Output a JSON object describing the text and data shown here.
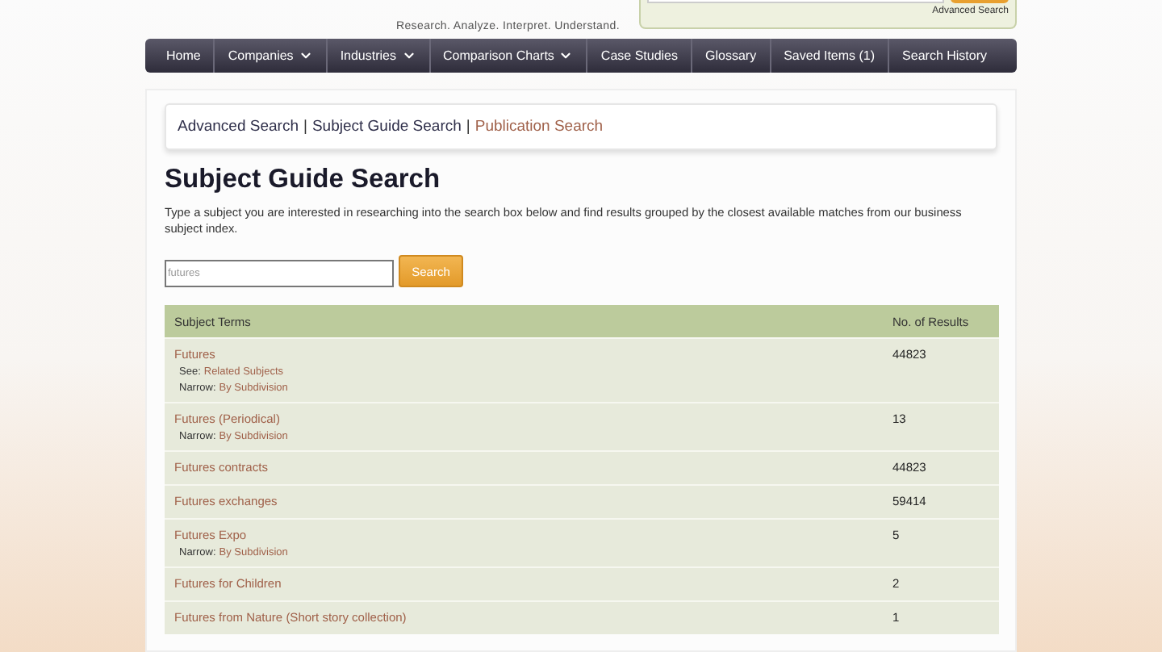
{
  "header": {
    "tagline": "Research. Analyze. Interpret. Understand.",
    "advanced_search_link": "Advanced Search"
  },
  "nav": [
    {
      "label": "Home",
      "has_menu": false
    },
    {
      "label": "Companies",
      "has_menu": true
    },
    {
      "label": "Industries",
      "has_menu": true
    },
    {
      "label": "Comparison Charts",
      "has_menu": true
    },
    {
      "label": "Case Studies",
      "has_menu": false
    },
    {
      "label": "Glossary",
      "has_menu": false
    },
    {
      "label": "Saved Items (1)",
      "has_menu": false
    },
    {
      "label": "Search History",
      "has_menu": false
    }
  ],
  "search_tabs": [
    {
      "label": "Advanced Search",
      "selected": false
    },
    {
      "label": "Subject Guide Search",
      "selected": false
    },
    {
      "label": "Publication Search",
      "selected": true
    }
  ],
  "separator": "|",
  "title": "Subject Guide Search",
  "description": "Type a subject you are interested in researching into the search box below and find results grouped by the closest available matches from our business subject index.",
  "search": {
    "value": "futures",
    "button": "Search"
  },
  "table": {
    "columns": [
      "Subject Terms",
      "No. of Results"
    ],
    "rows": [
      {
        "term": "Futures",
        "count": "44823",
        "refs": [
          {
            "label": "See:",
            "link": "Related Subjects"
          },
          {
            "label": "Narrow:",
            "link": "By Subdivision"
          }
        ]
      },
      {
        "term": "Futures (Periodical)",
        "count": "13",
        "refs": [
          {
            "label": "Narrow:",
            "link": "By Subdivision"
          }
        ]
      },
      {
        "term": "Futures contracts",
        "count": "44823",
        "refs": []
      },
      {
        "term": "Futures exchanges",
        "count": "59414",
        "refs": []
      },
      {
        "term": "Futures Expo",
        "count": "5",
        "refs": [
          {
            "label": "Narrow:",
            "link": "By Subdivision"
          }
        ]
      },
      {
        "term": "Futures for Children",
        "count": "2",
        "refs": []
      },
      {
        "term": "Futures from Nature (Short story collection)",
        "count": "1",
        "refs": []
      }
    ]
  }
}
